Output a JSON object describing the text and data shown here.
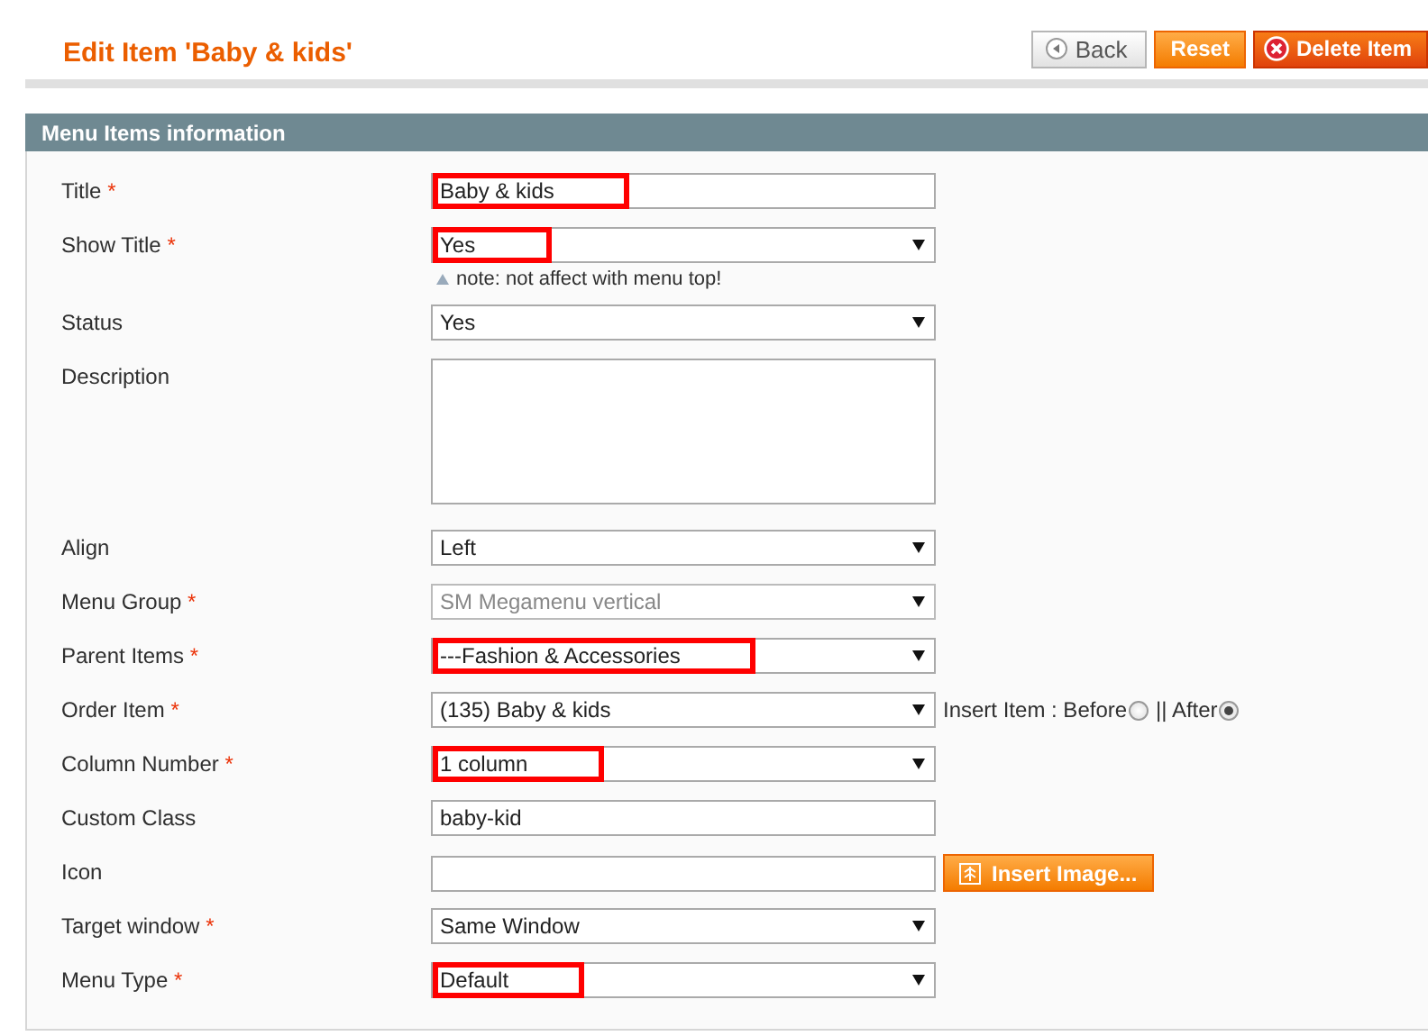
{
  "page_title": "Edit Item 'Baby & kids'",
  "buttons": [
    {
      "kind": "back",
      "label": "Back"
    },
    {
      "kind": "reset",
      "label": "Reset"
    },
    {
      "kind": "delete",
      "label": "Delete Item"
    }
  ],
  "section": {
    "title": "Menu Items information"
  },
  "fields": [
    {
      "kind": "text",
      "label": "Title",
      "mark": "*",
      "value": "Baby & kids",
      "highlighted": true
    },
    {
      "kind": "select",
      "label": "Show Title",
      "mark": "*",
      "value": "Yes",
      "disabled": false,
      "highlighted": true,
      "note": "note: not affect with menu top!"
    },
    {
      "kind": "select",
      "label": "Status",
      "value": "Yes",
      "disabled": false
    },
    {
      "kind": "textarea",
      "label": "Description"
    },
    {
      "kind": "select",
      "label": "Align",
      "value": "Left",
      "disabled": false
    },
    {
      "kind": "select",
      "label": "Menu Group",
      "mark": "*",
      "value": "SM Megamenu vertical",
      "disabled": true
    },
    {
      "kind": "select",
      "label": "Parent Items",
      "mark": "*",
      "value": "---Fashion & Accessories",
      "disabled": false,
      "highlighted": true
    },
    {
      "kind": "select",
      "label": "Order Item",
      "mark": "*",
      "value": "(135) Baby & kids",
      "disabled": false,
      "options": [
        {
          "label": "Insert Item : Before",
          "selected": false
        },
        {
          "label": "|| After",
          "selected": true
        }
      ]
    },
    {
      "kind": "select",
      "label": "Column Number",
      "mark": "*",
      "value": "1 column",
      "disabled": false,
      "highlighted": true
    },
    {
      "kind": "text",
      "label": "Custom Class",
      "value": "baby-kid"
    },
    {
      "kind": "text",
      "label": "Icon",
      "button": "Insert Image..."
    },
    {
      "kind": "select",
      "label": "Target window",
      "mark": "*",
      "value": "Same Window",
      "disabled": false
    },
    {
      "kind": "select",
      "label": "Menu Type",
      "mark": "*",
      "value": "Default",
      "disabled": false,
      "highlighted": true
    }
  ]
}
